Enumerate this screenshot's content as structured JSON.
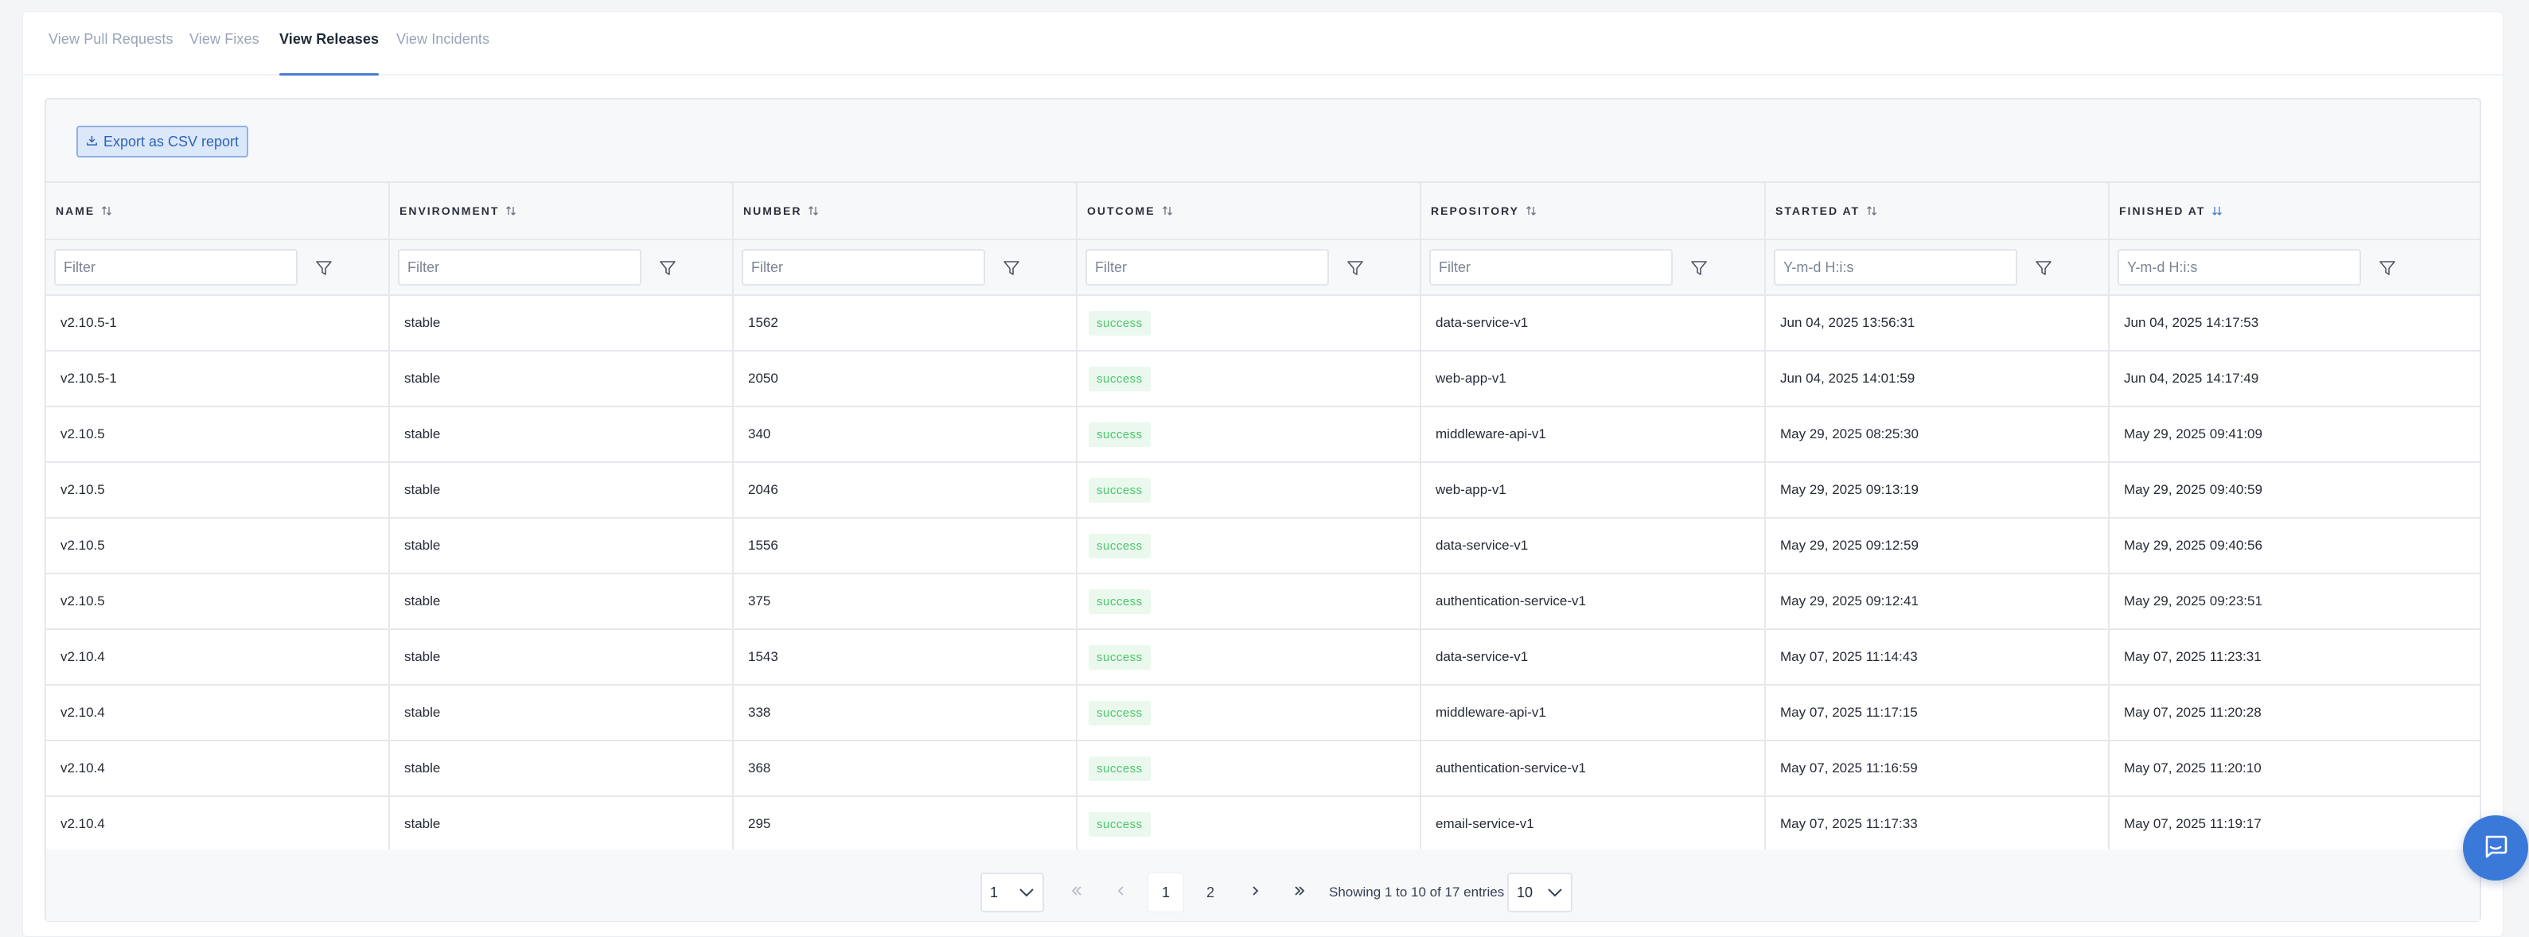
{
  "tabs": [
    {
      "label": "View Pull Requests",
      "active": false
    },
    {
      "label": "View Fixes",
      "active": false
    },
    {
      "label": "View Releases",
      "active": true
    },
    {
      "label": "View Incidents",
      "active": false
    }
  ],
  "export_button": {
    "label": "Export as CSV report",
    "icon": "download-icon"
  },
  "table": {
    "columns": [
      {
        "label": "NAME",
        "sort_icon": "sort-both-icon",
        "filter_placeholder": "Filter"
      },
      {
        "label": "ENVIRONMENT",
        "sort_icon": "sort-both-icon",
        "filter_placeholder": "Filter"
      },
      {
        "label": "NUMBER",
        "sort_icon": "sort-both-icon",
        "filter_placeholder": "Filter"
      },
      {
        "label": "OUTCOME",
        "sort_icon": "sort-both-icon",
        "filter_placeholder": "Filter"
      },
      {
        "label": "REPOSITORY",
        "sort_icon": "sort-both-icon",
        "filter_placeholder": "Filter"
      },
      {
        "label": "STARTED AT",
        "sort_icon": "sort-both-icon",
        "filter_placeholder": "Y-m-d H:i:s"
      },
      {
        "label": "FINISHED AT",
        "sort_icon": "sort-desc-icon",
        "filter_placeholder": "Y-m-d H:i:s"
      }
    ],
    "rows": [
      [
        "v2.10.5-1",
        "stable",
        "1562",
        "success",
        "data-service-v1",
        "Jun 04, 2025 13:56:31",
        "Jun 04, 2025 14:17:53"
      ],
      [
        "v2.10.5-1",
        "stable",
        "2050",
        "success",
        "web-app-v1",
        "Jun 04, 2025 14:01:59",
        "Jun 04, 2025 14:17:49"
      ],
      [
        "v2.10.5",
        "stable",
        "340",
        "success",
        "middleware-api-v1",
        "May 29, 2025 08:25:30",
        "May 29, 2025 09:41:09"
      ],
      [
        "v2.10.5",
        "stable",
        "2046",
        "success",
        "web-app-v1",
        "May 29, 2025 09:13:19",
        "May 29, 2025 09:40:59"
      ],
      [
        "v2.10.5",
        "stable",
        "1556",
        "success",
        "data-service-v1",
        "May 29, 2025 09:12:59",
        "May 29, 2025 09:40:56"
      ],
      [
        "v2.10.5",
        "stable",
        "375",
        "success",
        "authentication-service-v1",
        "May 29, 2025 09:12:41",
        "May 29, 2025 09:23:51"
      ],
      [
        "v2.10.4",
        "stable",
        "1543",
        "success",
        "data-service-v1",
        "May 07, 2025 11:14:43",
        "May 07, 2025 11:23:31"
      ],
      [
        "v2.10.4",
        "stable",
        "338",
        "success",
        "middleware-api-v1",
        "May 07, 2025 11:17:15",
        "May 07, 2025 11:20:28"
      ],
      [
        "v2.10.4",
        "stable",
        "368",
        "success",
        "authentication-service-v1",
        "May 07, 2025 11:16:59",
        "May 07, 2025 11:20:10"
      ],
      [
        "v2.10.4",
        "stable",
        "295",
        "success",
        "email-service-v1",
        "May 07, 2025 11:17:33",
        "May 07, 2025 11:19:17"
      ]
    ]
  },
  "pagination": {
    "page_select": "1",
    "pages": [
      "1",
      "2"
    ],
    "current_page": "1",
    "info": "Showing 1 to 10 of 17 entries",
    "page_size": "10"
  },
  "colors": {
    "accent": "#4a7bd4",
    "success_text": "#4cc46d",
    "success_bg": "#eaf8ee",
    "chat_button": "#3b79d9"
  },
  "chat_button": {
    "icon": "chat-icon"
  }
}
